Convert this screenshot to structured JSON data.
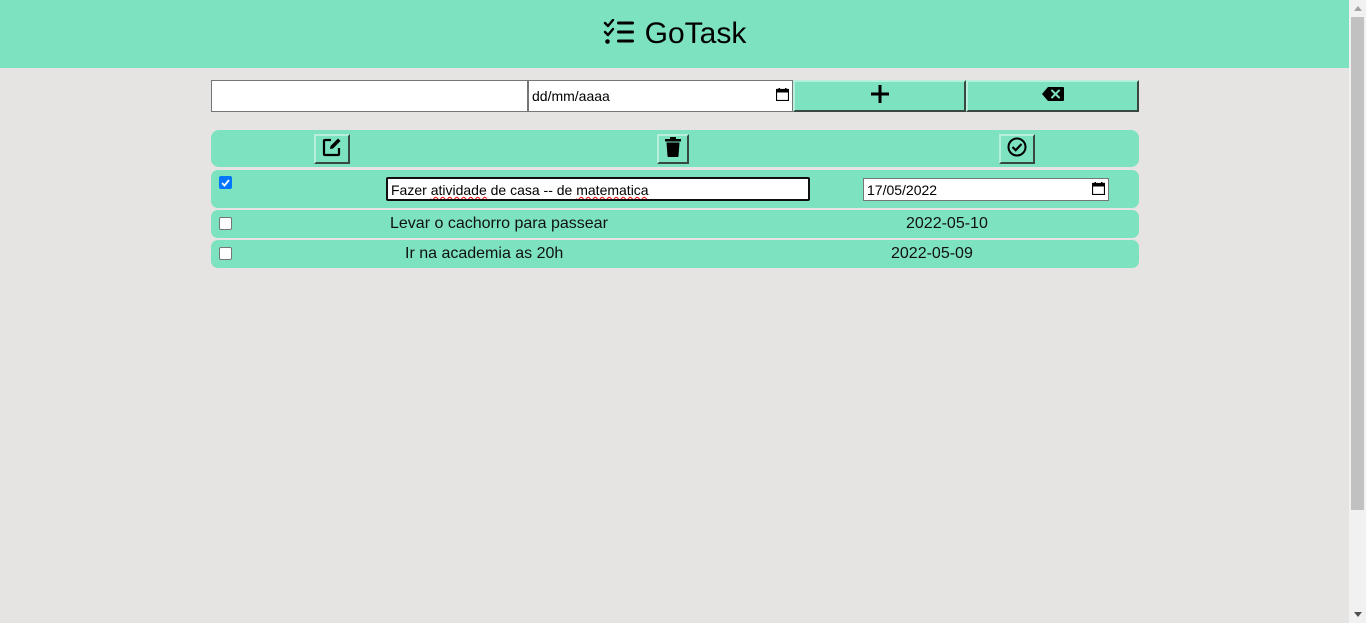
{
  "header": {
    "title": "GoTask",
    "logo_icon": "task-list-icon",
    "background": "#7de2bf"
  },
  "form": {
    "task_value": "",
    "date_placeholder": "dd/mm/aaaa",
    "add_icon": "plus-icon",
    "clear_icon": "backspace-icon"
  },
  "toolbar": {
    "edit_icon": "edit-icon",
    "delete_icon": "trash-icon",
    "complete_icon": "check-circle-icon"
  },
  "tasks": [
    {
      "checked": true,
      "editing": true,
      "text_parts": [
        "Fazer ",
        "atividade",
        " de casa -- de ",
        "matematica"
      ],
      "date": "17/05/2022"
    },
    {
      "checked": false,
      "editing": false,
      "text": "Levar o cachorro para passear",
      "date": "2022-05-10"
    },
    {
      "checked": false,
      "editing": false,
      "text": "Ir na academia as 20h",
      "date": "2022-05-09"
    }
  ]
}
